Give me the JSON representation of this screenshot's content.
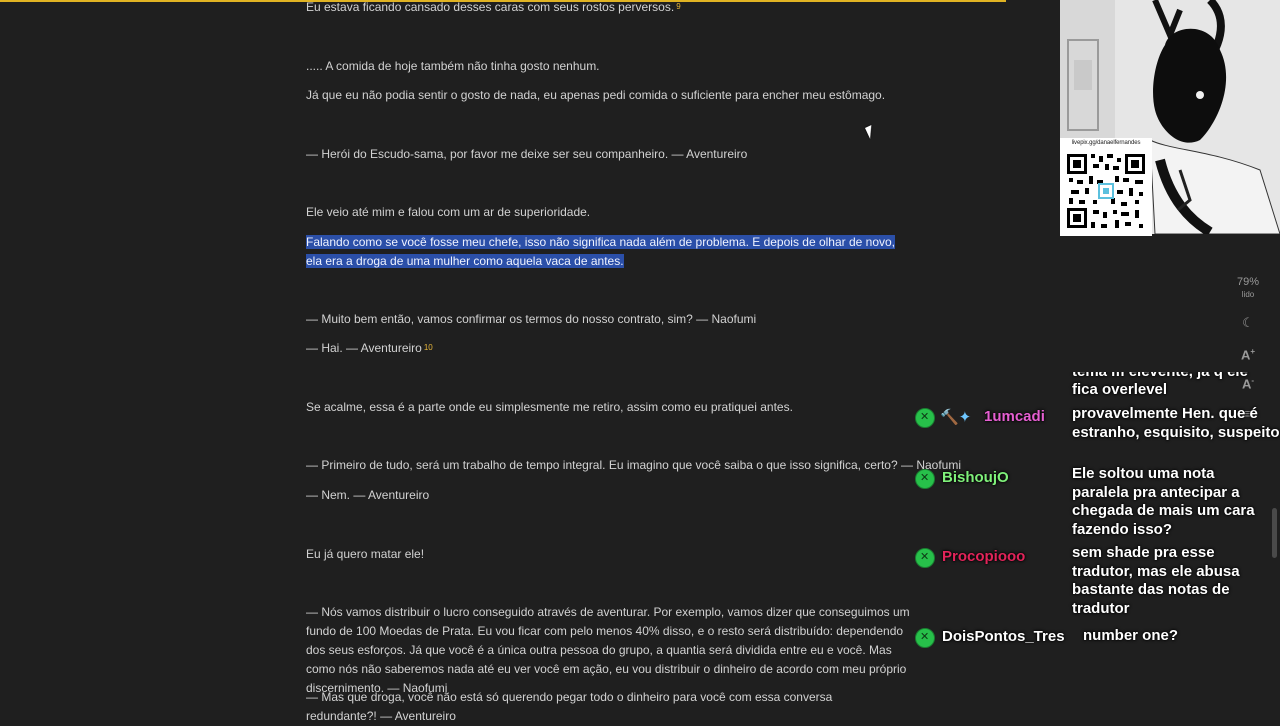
{
  "article": {
    "lines": [
      {
        "text": "Eu estava ficando cansado desses caras com seus rostos perversos.",
        "note": "9"
      },
      {
        "text": "..... A comida de hoje também não tinha gosto nenhum."
      },
      {
        "text": "Já que eu não podia sentir o gosto de nada, eu apenas pedi comida o suficiente para encher meu estômago."
      },
      {
        "text": "— Herói do Escudo-sama, por favor me deixe ser seu companheiro. — Aventureiro"
      },
      {
        "text": "Ele veio até mim e falou com um ar de superioridade."
      },
      {
        "text": "Falando como se você fosse meu chefe, isso não significa nada além de problema. E depois de olhar de novo, ela era a droga de uma mulher como aquela vaca de antes."
      },
      {
        "text": "— Muito bem então, vamos confirmar os termos do nosso contrato, sim? — Naofumi"
      },
      {
        "text": "— Hai. — Aventureiro",
        "note": "10"
      },
      {
        "text": "Se acalme, essa é a parte onde eu simplesmente me retiro, assim como eu pratiquei antes."
      },
      {
        "text": "— Primeiro de tudo, será um trabalho de tempo integral. Eu imagino que você saiba o que isso significa, certo? — Naofumi"
      },
      {
        "text": "— Nem. — Aventureiro"
      },
      {
        "text": "Eu já quero matar ele!"
      },
      {
        "text": "— Nós vamos distribuir o lucro conseguido através de aventurar. Por exemplo, vamos dizer que conseguimos um fundo de 100 Moedas de Prata. Eu vou ficar com pelo menos 40% disso, e o resto será distribuído: dependendo dos seus esforços. Já que você é a única outra pessoa do grupo, a quantia será dividida entre eu e você. Mas como nós não saberemos nada até eu ver você em ação, eu vou distribuir o dinheiro de acordo com meu próprio discernimento. — Naofumi"
      },
      {
        "text": "— Mas que droga, você não está só querendo pegar todo o dinheiro para você com essa conversa redundante?! — Aventureiro"
      }
    ]
  },
  "overlay": {
    "qr_url": "livepix.gg/danaelfernandes"
  },
  "reader_tools": {
    "progress": "79%",
    "progress_label": "lido"
  },
  "chat": {
    "partial_top": "tema m elevente, já q ele\nfica overlevel",
    "messages": [
      {
        "user": "1umcadi",
        "emotes": "🔨✦",
        "color": "#e65fd2",
        "text": "provavelmente Hen. que é estranho, esquisito, suspeito"
      },
      {
        "user": "BishoujO",
        "color": "#7ff07a",
        "text": "Ele soltou uma nota paralela pra antecipar a chegada de mais um cara fazendo isso?"
      },
      {
        "user": "Procopiooo",
        "color": "#e2245a",
        "text": "sem shade pra esse tradutor, mas ele abusa bastante das notas de tradutor"
      },
      {
        "user": "DoisPontos_Tres",
        "color": "#ffffff",
        "text": "number one?"
      }
    ]
  }
}
